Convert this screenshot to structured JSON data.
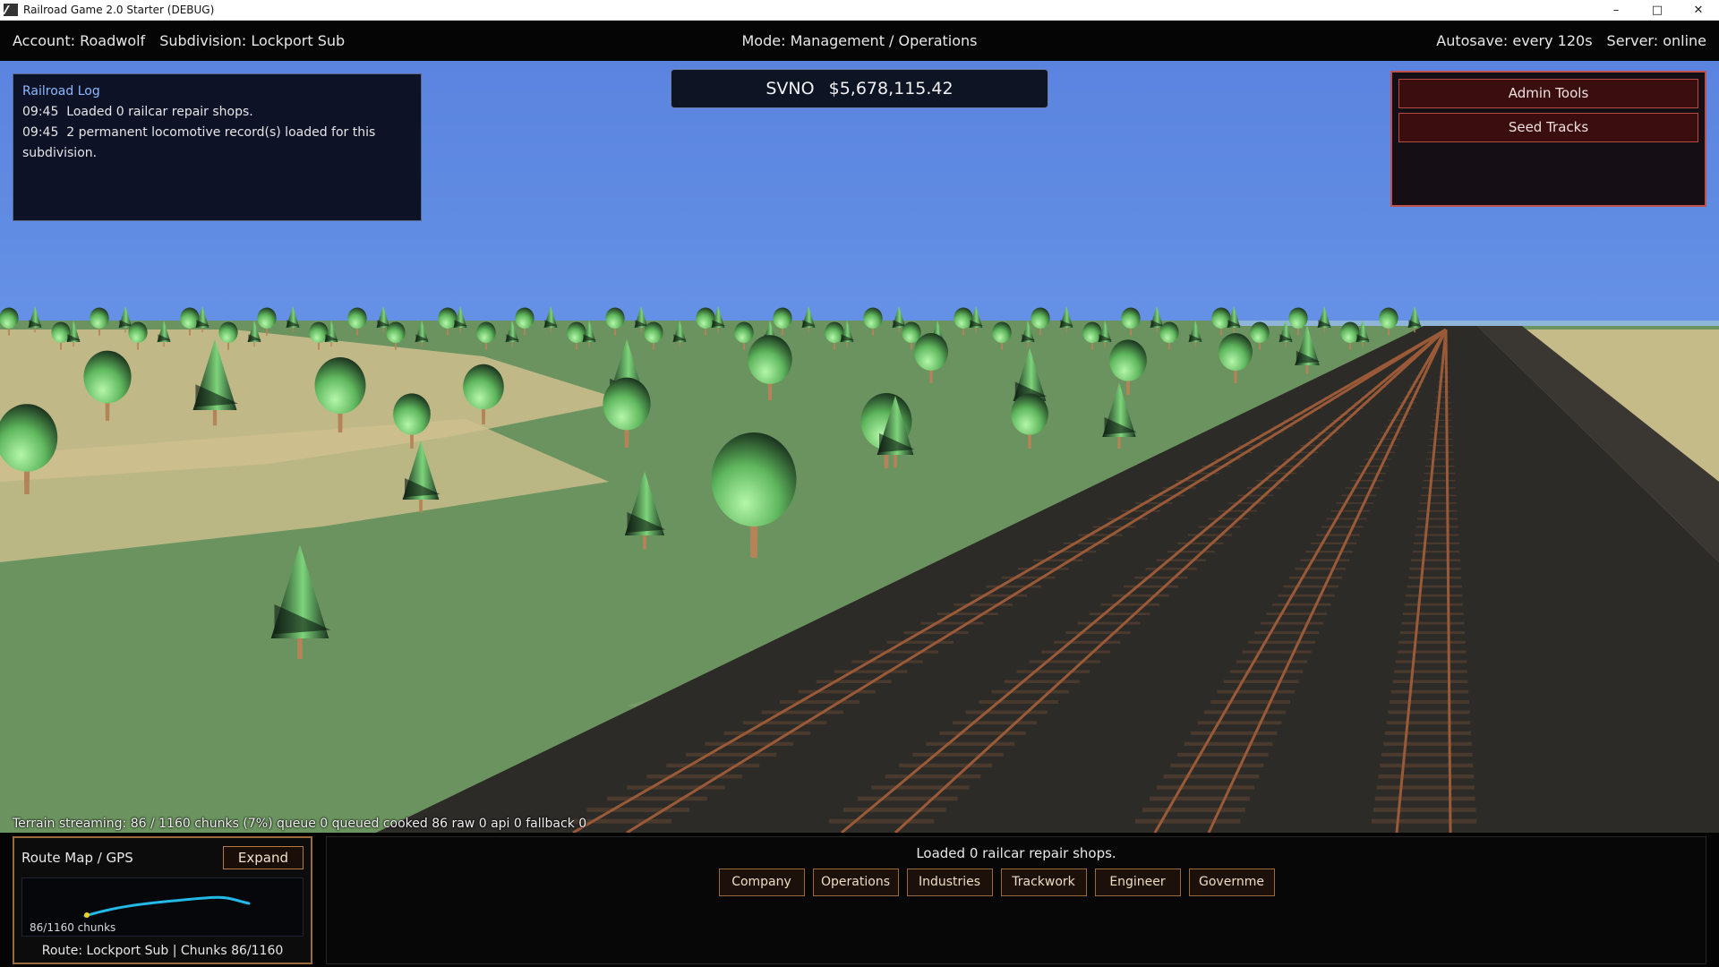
{
  "window": {
    "title": "Railroad Game 2.0 Starter (DEBUG)",
    "controls": {
      "minimize": "–",
      "maximize": "□",
      "close": "✕"
    }
  },
  "hud": {
    "account": "Account: Roadwolf",
    "subdivision": "Subdivision: Lockport Sub",
    "mode": "Mode: Management / Operations",
    "autosave": "Autosave: every 120s",
    "server": "Server: online"
  },
  "log": {
    "title": "Railroad Log",
    "entries": [
      {
        "time": "09:45",
        "text": "Loaded 0 railcar repair shops."
      },
      {
        "time": "09:45",
        "text": "2 permanent locomotive record(s) loaded for this subdivision."
      }
    ]
  },
  "balance": {
    "reporting_mark": "SVNO",
    "amount": "$5,678,115.42"
  },
  "admin": {
    "admin_tools_label": "Admin Tools",
    "seed_tracks_label": "Seed Tracks"
  },
  "streaming": {
    "text": "Terrain streaming: 86 / 1160 chunks (7%)  queue 0  queued  cooked 86  raw 0  api 0  fallback 0"
  },
  "route_map": {
    "title": "Route Map / GPS",
    "expand_label": "Expand",
    "chunks_label": "86/1160 chunks",
    "footer": "Route: Lockport Sub  |  Chunks 86/1160",
    "route_color": "#22b8e8",
    "marker_color": "#f0d020"
  },
  "ops": {
    "message": "Loaded 0 railcar repair shops.",
    "tabs": [
      "Company",
      "Operations",
      "Industries",
      "Trackwork",
      "Engineer",
      "Governme"
    ]
  },
  "colors": {
    "sky": "#5b86e0",
    "grass": "#6b935f",
    "sand": "#cfc08e",
    "ballast": "#2d2b28",
    "rail": "#9a5a38",
    "tie": "#4a3a2e",
    "foliage_light": "#a8f0a0",
    "foliage_dark": "#16261a",
    "trunk": "#b48458"
  }
}
